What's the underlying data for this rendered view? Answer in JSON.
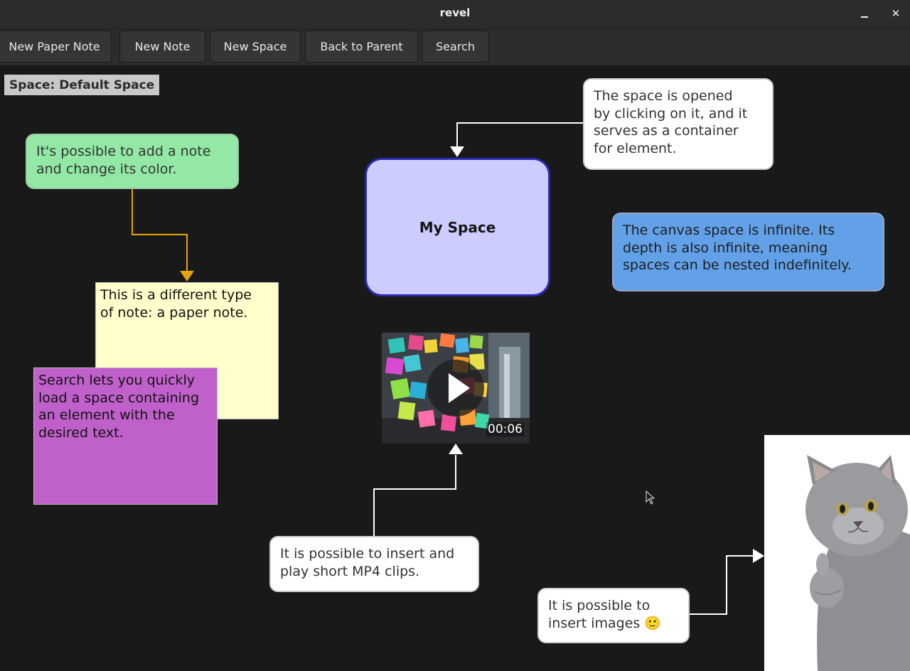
{
  "window": {
    "title": "revel"
  },
  "toolbar": {
    "new_paper_note": "New Paper Note",
    "new_note": "New Note",
    "new_space": "New Space",
    "back_to_parent": "Back to Parent",
    "search": "Search"
  },
  "canvas": {
    "space_label": "Space: Default Space",
    "notes": {
      "green": "It's possible to add a note\nand change its color.",
      "space_info": "The space is opened\nby clicking on it, and it\nserves as a container\nfor element.",
      "canvas_info": "The canvas space is infinite. Its\ndepth is also infinite, meaning\nspaces can be nested indefinitely.",
      "mp4_info": "It is possible to insert and\nplay short MP4 clips.",
      "images_info": "It is possible to\ninsert images 🙂"
    },
    "paper_notes": {
      "yellow": "This is a different type\nof note: a paper note.",
      "purple": "Search lets you quickly\nload a space containing\nan element with the\ndesired text."
    },
    "space": {
      "label": "My Space"
    },
    "video": {
      "duration": "00:06"
    }
  },
  "colors": {
    "green_note": "#92e8a4",
    "blue_note": "#62a0e8",
    "paper_yellow": "#ffffcc",
    "paper_purple": "#c061cb",
    "space_fill": "#ccccff",
    "space_border": "#2a2ab0",
    "connector_orange": "#e5a50a",
    "connector_white": "#ffffff"
  },
  "icons": {
    "minimize": "minimize-icon",
    "close": "close-icon",
    "play": "play-icon",
    "cursor": "mouse-pointer-icon"
  }
}
